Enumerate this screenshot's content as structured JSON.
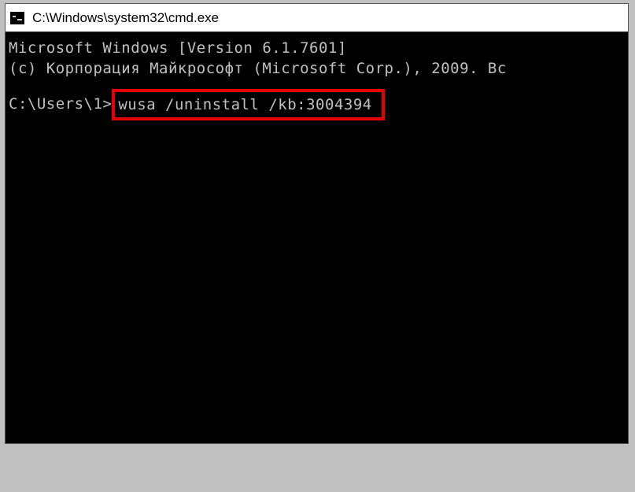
{
  "window": {
    "title": "C:\\Windows\\system32\\cmd.exe"
  },
  "console": {
    "line1": "Microsoft Windows [Version 6.1.7601]",
    "line2": "(c) Корпорация Майкрософт (Microsoft Corp.), 2009. Вс",
    "prompt": "C:\\Users\\1>",
    "command": "wusa /uninstall /kb:3004394"
  }
}
